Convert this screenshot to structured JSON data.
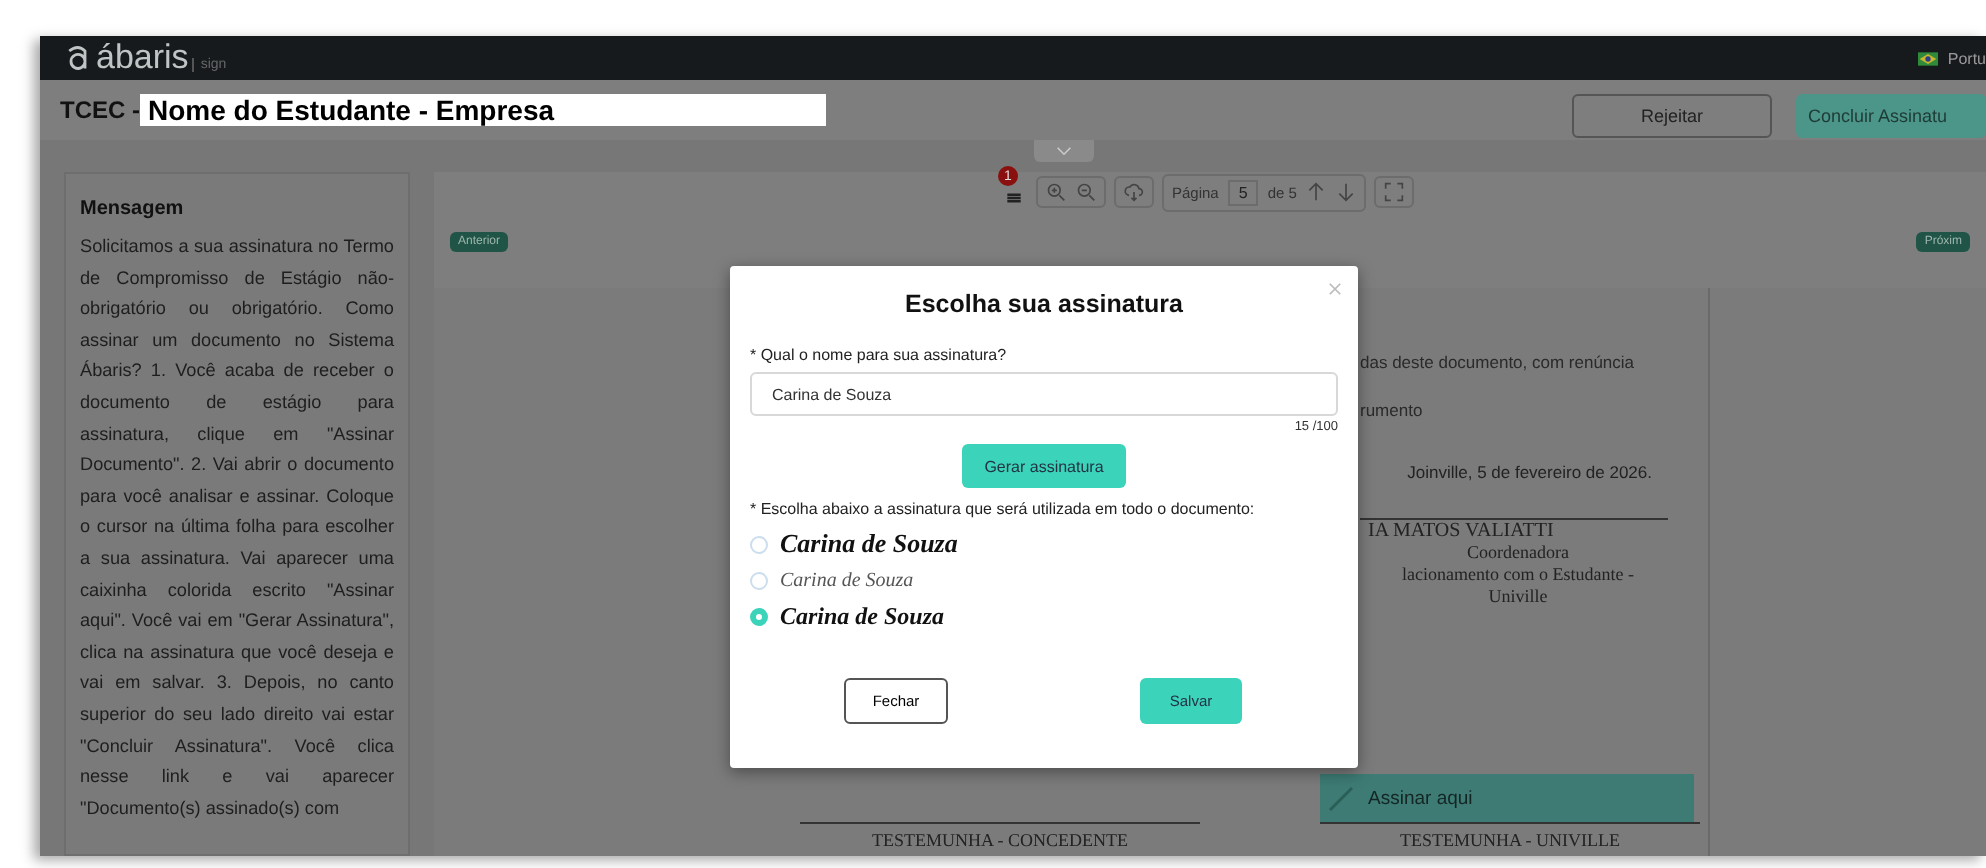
{
  "topbar": {
    "logo": "ábaris",
    "logo_suffix": "sign",
    "language": "Portu"
  },
  "header": {
    "prefix": "TCEC - ",
    "title": "Nome do Estudante - Empresa",
    "buttons": [
      {
        "label": "Rejeitar",
        "kind": "outline"
      },
      {
        "label": "Concluir Assinatu",
        "kind": "primary"
      }
    ]
  },
  "message": {
    "title": "Mensagem",
    "text": "Solicitamos a sua assinatura no Termo de Compromisso de Estágio não-obrigatório ou obrigatório. Como assinar um documento no Sistema Ábaris? 1. Você acaba de receber o documento de estágio para assinatura, clique em \"Assinar Documento\". 2. Vai abrir o documento para você analisar e assinar. Coloque o cursor na última folha para escolher a sua assinatura. Vai aparecer uma caixinha colorida escrito \"Assinar aqui\". Você vai em \"Gerar Assinatura\", clica na assinatura que você deseja e vai em salvar. 3. Depois, no canto superior do seu lado direito vai estar \"Concluir Assinatura\". Você clica nesse link e vai aparecer \"Documento(s) assinado(s) com"
  },
  "toolbar": {
    "badge": "1",
    "page_label": "Página",
    "page": "5",
    "page_total": "de 5"
  },
  "navigation": {
    "previous": "Anterior",
    "next": "Próxim"
  },
  "document": {
    "lines": [
      "das deste documento, com renúncia",
      "rumento"
    ],
    "date": "Joinville, 5 de fevereiro de 2026.",
    "signer": [
      "IA MATOS VALIATTI",
      "Coordenadora",
      "lacionamento com o Estudante -",
      "Univille"
    ],
    "sign_here": "Assinar aqui",
    "witnesses": [
      "TESTEMUNHA - CONCEDENTE",
      "TESTEMUNHA - UNIVILLE"
    ]
  },
  "modal": {
    "title": "Escolha sua assinatura",
    "name_label": "* Qual o nome para sua assinatura?",
    "name_value": "Carina de Souza",
    "counter": "15 /100",
    "generate": "Gerar assinatura",
    "choose_label": "* Escolha abaixo a assinatura que será utilizada em todo o documento:",
    "options": [
      {
        "text": "Carina de Souza",
        "selected": false
      },
      {
        "text": "Carina de Souza",
        "selected": false
      },
      {
        "text": "Carina de Souza",
        "selected": true
      }
    ],
    "close": "Fechar",
    "save": "Salvar"
  }
}
